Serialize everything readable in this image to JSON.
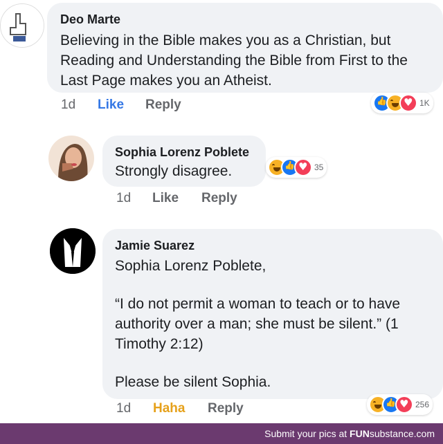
{
  "comments": [
    {
      "name": "Deo Marte",
      "text_lines": [
        "Believing in the Bible makes you as a Christian, but",
        "Reading and Understanding the Bible from First to the",
        "Last Page makes you an Atheist."
      ],
      "time": "1d",
      "like": "Like",
      "reply": "Reply",
      "reaction_count": "1K",
      "avatar_icon": "hand-pointing-up-icon"
    },
    {
      "name": "Sophia Lorenz Poblete",
      "text_lines": [
        "Strongly disagree."
      ],
      "time": "1d",
      "like": "Like",
      "reply": "Reply",
      "reaction_count": "35",
      "avatar_icon": "profile-photo"
    },
    {
      "name": "Jamie Suarez",
      "text_lines": [
        "Sophia Lorenz Poblete,",
        "",
        "“I do not permit a woman to teach or to have",
        "authority over a man; she must be silent.” (1",
        "Timothy 2:12)",
        "",
        "Please be silent Sophia."
      ],
      "time": "1d",
      "like": "Haha",
      "reply": "Reply",
      "reaction_count": "256",
      "avatar_icon": "suit-silhouette-icon"
    }
  ],
  "footer": {
    "prefix": "Submit your pics at ",
    "brand_bold": "FUN",
    "brand_rest": "substance.com"
  },
  "colors": {
    "bubble": "#f0f2f5",
    "like_blue": "#3578e5",
    "haha_yellow": "#e6a11b",
    "footer_bg": "#6b3a6f"
  }
}
